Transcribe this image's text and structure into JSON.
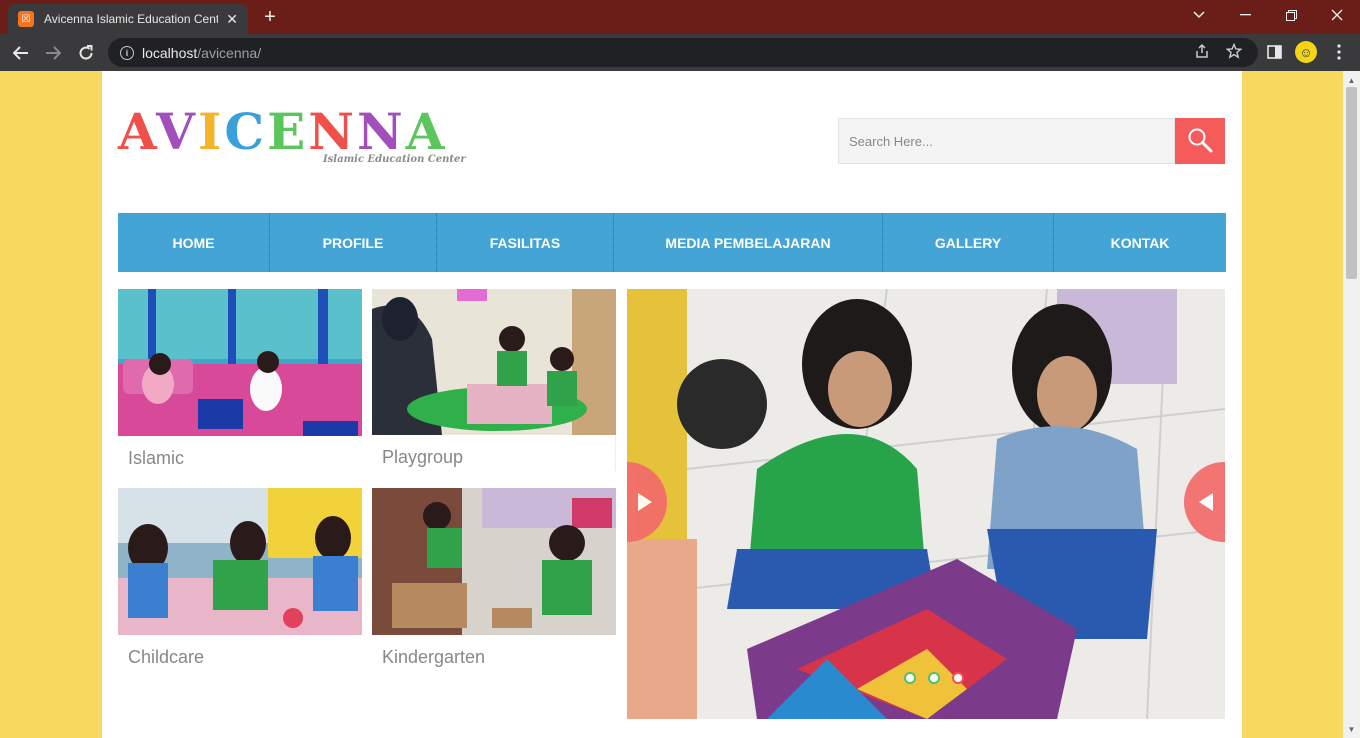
{
  "browser": {
    "tab_title": "Avicenna Islamic Education Center",
    "tab_favicon_glyph": "☒",
    "url_host": "localhost",
    "url_path": "/avicenna/",
    "new_tab_glyph": "+",
    "close_glyph": "✕"
  },
  "site": {
    "logo": {
      "letters": [
        "A",
        "V",
        "I",
        "C",
        "E",
        "N",
        "N",
        "A"
      ],
      "letter_colors": [
        "#f0504a",
        "#a34fbb",
        "#f3b42a",
        "#3aa0d9",
        "#5cc55c",
        "#f0504a",
        "#a34fbb",
        "#5cc55c"
      ],
      "subtitle": "Islamic Education Center"
    },
    "search": {
      "placeholder": "Search Here...",
      "button_icon": "search-icon"
    },
    "menu": [
      {
        "label": "HOME"
      },
      {
        "label": "PROFILE"
      },
      {
        "label": "FASILITAS"
      },
      {
        "label": "MEDIA PEMBELAJARAN"
      },
      {
        "label": "GALLERY"
      },
      {
        "label": "KONTAK"
      }
    ],
    "programs": [
      {
        "label": "Islamic"
      },
      {
        "label": "Playgroup"
      },
      {
        "label": "Childcare"
      },
      {
        "label": "Kindergarten"
      }
    ],
    "slider": {
      "dot_count": 3,
      "active_dot": 3,
      "dot_colors": {
        "inactive": "#4cc36a",
        "active": "#f05050"
      }
    }
  },
  "colors": {
    "page_background": "#f7d95f",
    "menu_blue": "#45a4d6",
    "accent_red": "#f55b5b"
  }
}
